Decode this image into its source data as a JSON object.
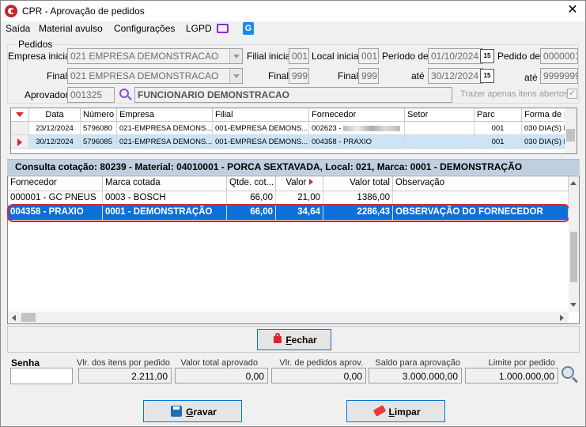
{
  "window": {
    "title": "CPR - Aprovação de pedidos",
    "close": "✕"
  },
  "menu": {
    "items": [
      "Saída",
      "Material avulso",
      "Configurações",
      "LGPD"
    ]
  },
  "pedidos": {
    "group_label": "Pedidos",
    "empresa_inicial_label": "Empresa inicial",
    "empresa_inicial": "021 EMPRESA DEMONSTRACAO",
    "final_label": "Final",
    "empresa_final": "021 EMPRESA DEMONSTRACAO",
    "filial_inicial_label": "Filial inicial",
    "filial_inicial": "001",
    "filial_final_label": "Final",
    "filial_final": "999",
    "local_inicial_label": "Local inicial",
    "local_inicial": "001",
    "local_final_label": "Final",
    "local_final": "999",
    "periodo_label": "Período de",
    "periodo_de": "01/10/2024",
    "ate_label": "até",
    "periodo_ate": "30/12/2024",
    "cal_label": "15",
    "pedido_de_label": "Pedido de",
    "pedido_de": "0000001",
    "pedido_ate_label": "até",
    "pedido_ate": "9999999",
    "aprovador_label": "Aprovador",
    "aprovador_code": "001325",
    "aprovador_name": "FUNCIONARIO DEMONSTRACAO",
    "trazer_label": "Trazer apenas itens abertos"
  },
  "orders_grid": {
    "headers": [
      "Data",
      "Número",
      "Empresa",
      "Filial",
      "Fornecedor",
      "Setor",
      "Parc",
      "Forma de paga"
    ],
    "rows": [
      {
        "data": "23/12/2024",
        "numero": "5796080",
        "empresa": "021-EMPRESA DEMONS...",
        "filial": "001-EMPRESA DEMONS...",
        "fornecedor": "002623 - ",
        "setor": "",
        "parc": "001",
        "forma": "030 DIA(S) DA"
      },
      {
        "data": "30/12/2024",
        "numero": "5796085",
        "empresa": "021-EMPRESA DEMONS...",
        "filial": "001-EMPRESA DEMONS...",
        "fornecedor": "004358 - PRAXIO",
        "setor": "",
        "parc": "001",
        "forma": "030 DIA(S) FO"
      }
    ]
  },
  "cotacao": {
    "bar": "Consulta cotação: 80239 - Material: 04010001 - PORCA SEXTAVADA,  Local: 021,  Marca: 0001 - DEMONSTRAÇÃO",
    "headers": [
      "Fornecedor",
      "Marca cotada",
      "Qtde. cot...",
      "Valor",
      "Valor total",
      "Observação"
    ],
    "rows": [
      {
        "fornecedor": "000001 - GC PNEUS",
        "marca": "0003 - BOSCH",
        "qtde": "66,00",
        "valor": "21,00",
        "total": "1386,00",
        "obs": ""
      },
      {
        "fornecedor": "004358 - PRAXIO",
        "marca": "0001 - DEMONSTRAÇÃO",
        "qtde": "66,00",
        "valor": "34,64",
        "total": "2286,43",
        "obs": "OBSERVAÇÃO DO FORNECEDOR"
      }
    ]
  },
  "fechar": {
    "prefix": "",
    "hot": "F",
    "rest": "echar"
  },
  "totals": {
    "senha_label": "Senha",
    "itens_label": "Vlr. dos itens por pedido",
    "itens_value": "2.211,00",
    "aprovado_label": "Valor total aprovado",
    "aprovado_value": "0,00",
    "pedidos_label": "Vlr. de pedidos aprov.",
    "pedidos_value": "0,00",
    "saldo_label": "Saldo para aprovação",
    "saldo_value": "3.000.000,00",
    "limite_label": "Limite por pedido",
    "limite_value": "1.000.000,00"
  },
  "buttons": {
    "gravar_hot": "G",
    "gravar_rest": "ravar",
    "limpar_hot": "L",
    "limpar_rest": "impar"
  },
  "colors": {
    "selection": "#0f6fd9",
    "highlight_ring": "#d9262c",
    "accent_blue": "#0078d7"
  }
}
